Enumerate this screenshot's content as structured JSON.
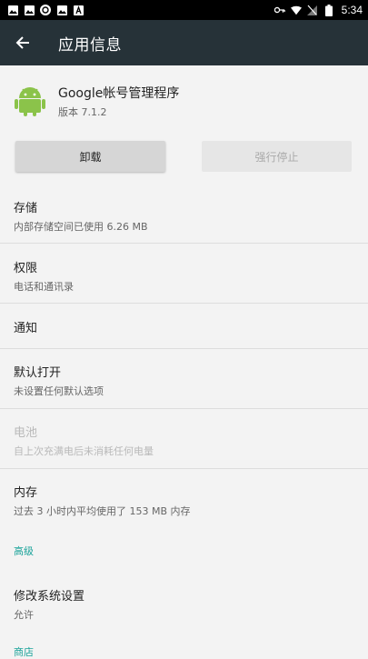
{
  "status_bar": {
    "left_icons": [
      "image-icon",
      "image-icon",
      "sync-icon",
      "image-icon",
      "a-icon"
    ],
    "right_icons": [
      "key-icon",
      "wifi-icon",
      "no-sim-icon",
      "battery-icon"
    ],
    "time": "5:34"
  },
  "app_bar": {
    "title": "应用信息"
  },
  "app": {
    "name": "Google帐号管理程序",
    "version": "版本 7.1.2"
  },
  "buttons": {
    "uninstall": "卸载",
    "force_stop": "强行停止"
  },
  "items": {
    "storage": {
      "title": "存储",
      "subtitle": "内部存储空间已使用 6.26 MB"
    },
    "permissions": {
      "title": "权限",
      "subtitle": "电话和通讯录"
    },
    "notifications": {
      "title": "通知"
    },
    "open_by_default": {
      "title": "默认打开",
      "subtitle": "未设置任何默认选项"
    },
    "battery": {
      "title": "电池",
      "subtitle": "自上次充满电后未消耗任何电量"
    },
    "memory": {
      "title": "内存",
      "subtitle": "过去 3 小时内平均使用了 153 MB 内存"
    }
  },
  "sections": {
    "advanced": "高级",
    "store": "商店"
  },
  "advanced_items": {
    "modify_system_settings": {
      "title": "修改系统设置",
      "subtitle": "允许"
    }
  },
  "colors": {
    "app_bar": "#263238",
    "accent": "#1aa39a",
    "android_green": "#8bc34a"
  }
}
